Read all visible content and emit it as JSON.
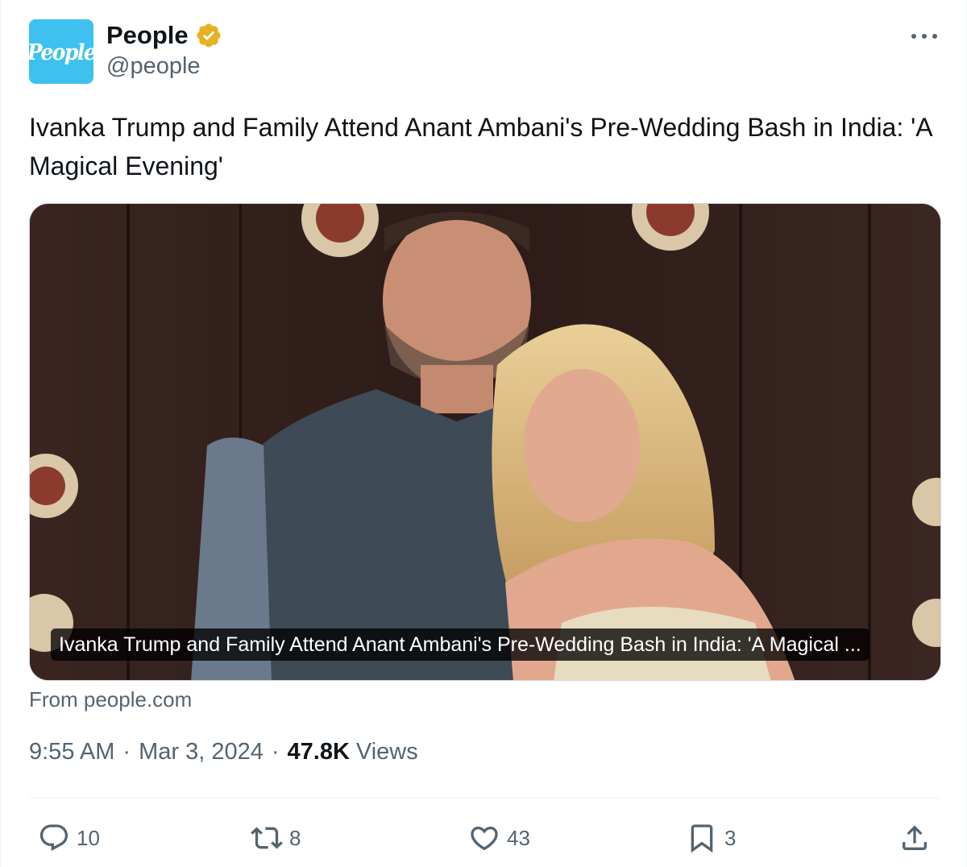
{
  "account": {
    "avatar_text": "People",
    "display_name": "People",
    "handle": "@people",
    "verified": true,
    "verified_color": "#e8b124"
  },
  "tweet": {
    "text": "Ivanka Trump and Family Attend Anant Ambani's Pre-Wedding Bash in India: 'A Magical Evening'"
  },
  "card": {
    "caption": "Ivanka Trump and Family Attend Anant Ambani's Pre-Wedding Bash in India: 'A Magical ...",
    "source": "From people.com"
  },
  "meta": {
    "time": "9:55 AM",
    "separator": "·",
    "date": "Mar 3, 2024",
    "views_count": "47.8K",
    "views_label": "Views"
  },
  "actions": {
    "replies": "10",
    "reposts": "8",
    "likes": "43",
    "bookmarks": "3"
  },
  "colors": {
    "avatar_bg": "#3ec1ef",
    "secondary_text": "#536471",
    "primary_text": "#0f1419"
  }
}
